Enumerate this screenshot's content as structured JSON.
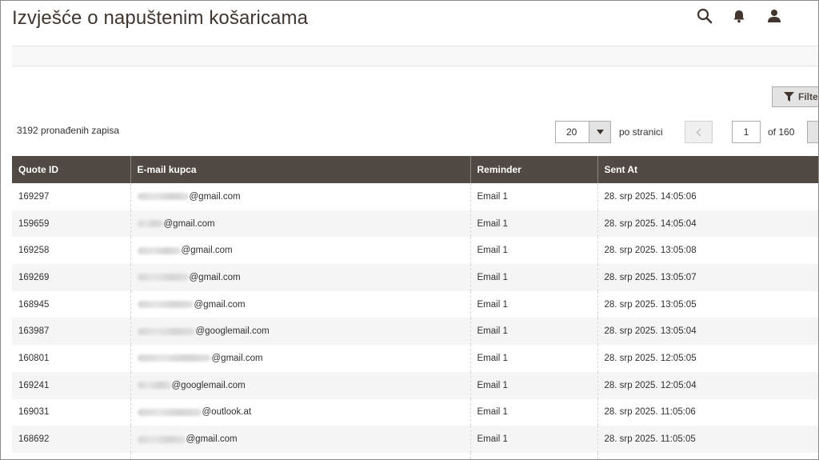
{
  "page": {
    "title": "Izvješće o napuštenim košaricama"
  },
  "header": {
    "icons": [
      "search-icon",
      "bell-icon",
      "user-icon"
    ]
  },
  "toolbar": {
    "filters_label": "Filter",
    "records_found": "3192 pronađenih zapisa",
    "per_page_value": "20",
    "per_page_label": "po stranici",
    "current_page": "1",
    "total_pages_label": "of 160"
  },
  "grid": {
    "columns": [
      "Quote ID",
      "E-mail kupca",
      "Reminder",
      "Sent At"
    ],
    "rows": [
      {
        "quote_id": "169297",
        "email_domain": "@gmail.com",
        "reminder": "Email 1",
        "sent_at": "28. srp 2025. 14:05:06"
      },
      {
        "quote_id": "159659",
        "email_domain": "@gmail.com",
        "reminder": "Email 1",
        "sent_at": "28. srp 2025. 14:05:04"
      },
      {
        "quote_id": "169258",
        "email_domain": "@gmail.com",
        "reminder": "Email 1",
        "sent_at": "28. srp 2025. 13:05:08"
      },
      {
        "quote_id": "169269",
        "email_domain": "@gmail.com",
        "reminder": "Email 1",
        "sent_at": "28. srp 2025. 13:05:07"
      },
      {
        "quote_id": "168945",
        "email_domain": "@gmail.com",
        "reminder": "Email 1",
        "sent_at": "28. srp 2025. 13:05:05"
      },
      {
        "quote_id": "163987",
        "email_domain": "@googlemail.com",
        "reminder": "Email 1",
        "sent_at": "28. srp 2025. 13:05:04"
      },
      {
        "quote_id": "160801",
        "email_domain": "@gmail.com",
        "reminder": "Email 1",
        "sent_at": "28. srp 2025. 12:05:05"
      },
      {
        "quote_id": "169241",
        "email_domain": "@googlemail.com",
        "reminder": "Email 1",
        "sent_at": "28. srp 2025. 12:05:04"
      },
      {
        "quote_id": "169031",
        "email_domain": "@outlook.at",
        "reminder": "Email 1",
        "sent_at": "28. srp 2025. 11:05:06"
      },
      {
        "quote_id": "168692",
        "email_domain": "@gmail.com",
        "reminder": "Email 1",
        "sent_at": "28. srp 2025. 11:05:05"
      },
      {
        "quote_id": "",
        "email_domain": "",
        "reminder": "",
        "sent_at": ""
      }
    ]
  },
  "colors": {
    "header_bg": "#514943",
    "title": "#41362f",
    "row_alt": "#f5f5f5"
  }
}
